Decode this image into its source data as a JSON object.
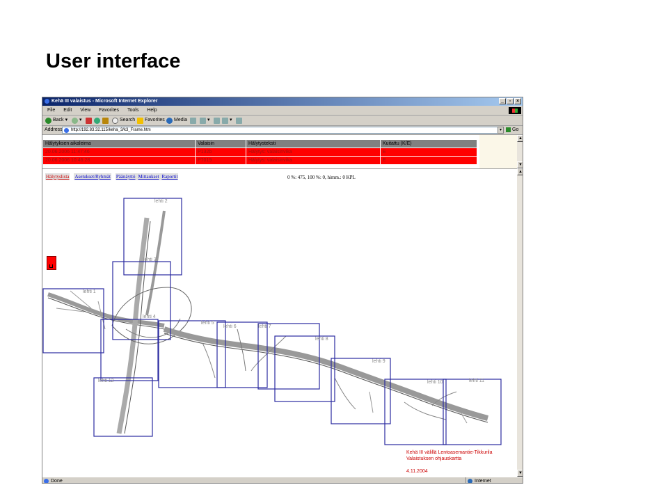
{
  "slide": {
    "title": "User interface"
  },
  "browser": {
    "window_title": "Kehä III valaistus - Microsoft Internet Explorer",
    "menu": [
      "File",
      "Edit",
      "View",
      "Favorites",
      "Tools",
      "Help"
    ],
    "toolbar": {
      "back": "Back",
      "search": "Search",
      "favorites": "Favorites",
      "media": "Media"
    },
    "address": {
      "label": "Address",
      "url": "http://192.83.32.115/keha_3/k3_Frame.htm",
      "go": "Go"
    },
    "status": {
      "text": "Done",
      "zone": "Internet"
    }
  },
  "alarms": {
    "columns": [
      "Hälytyksen aikaleima",
      "Valaisin",
      "Hälytysteksti",
      "Kuitattu (K/E)"
    ],
    "rows": [
      [
        "20.06.2006 11:47:46",
        "P132b",
        "Hälytys: valaisinvika",
        "E"
      ],
      [
        "20.06.2006 10:46:28",
        "P7019",
        "Hälytys: valaisinvika",
        "E"
      ]
    ]
  },
  "nav": {
    "links": [
      "Hälytyslista",
      "Asetukset/Ryhmät",
      "Päänäyttö",
      "Mittaukset",
      "Raportit"
    ],
    "active": "Hälytyslista"
  },
  "stats": "0 %: 475, 100 %: 0, himm.: 0 KPL",
  "map": {
    "sheets": [
      {
        "label": "lehti 1"
      },
      {
        "label": "lehti 2"
      },
      {
        "label": "lehti 3"
      },
      {
        "label": "lehti 4"
      },
      {
        "label": "lehti 5"
      },
      {
        "label": "lehti 6"
      },
      {
        "label": "lehti 7"
      },
      {
        "label": "lehti 8"
      },
      {
        "label": "lehti 9"
      },
      {
        "label": "lehti 10"
      },
      {
        "label": "lehti 11"
      },
      {
        "label": "lehti 12"
      }
    ],
    "caption": {
      "line1": "Kehä III välillä Lentoasemantie-Tikkurila",
      "line2": "Valaistuksen ohjauskartta",
      "date": "4.11.2004"
    }
  },
  "colors": {
    "alarm_row": "#ff0000",
    "alarm_header": "#808080",
    "sheet_border": "#2a2aa0",
    "caption": "#cc0000"
  }
}
